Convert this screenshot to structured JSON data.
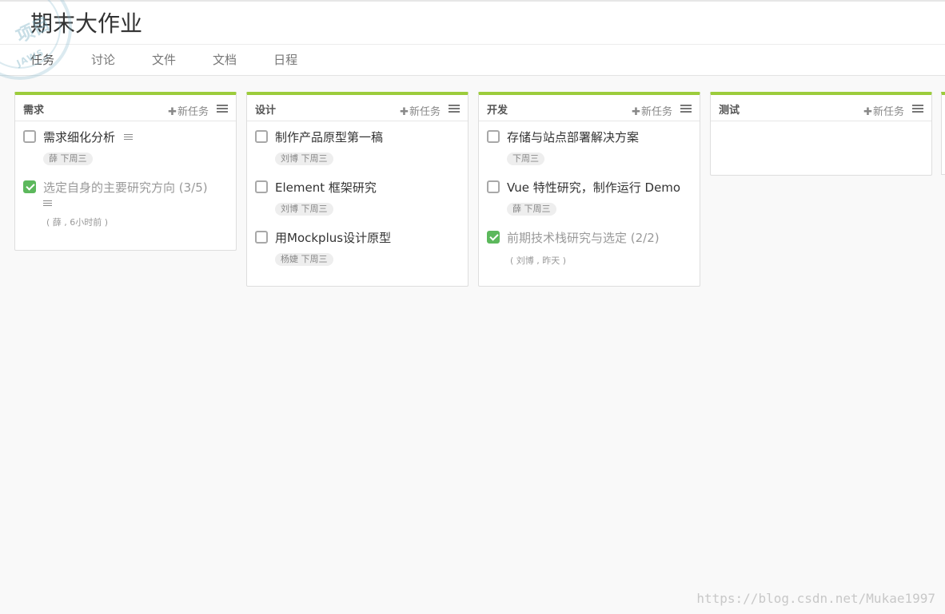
{
  "project": {
    "title": "期末大作业"
  },
  "stamp": {
    "text": "项目",
    "sub": "JAWS"
  },
  "tabs": [
    {
      "label": "任务",
      "active": true
    },
    {
      "label": "讨论"
    },
    {
      "label": "文件"
    },
    {
      "label": "文档"
    },
    {
      "label": "日程"
    }
  ],
  "add_task_label": "新任务",
  "columns": [
    {
      "name": "需求",
      "tasks": [
        {
          "title": "需求细化分析",
          "done": false,
          "has_note": true,
          "tag": "薛 下周三"
        },
        {
          "title": "选定自身的主要研究方向 (3/5)",
          "done": true,
          "has_note": true,
          "meta": "( 薛 , 6小时前 )"
        }
      ]
    },
    {
      "name": "设计",
      "tasks": [
        {
          "title": "制作产品原型第一稿",
          "done": false,
          "tag": "刘博 下周三"
        },
        {
          "title": "Element 框架研究",
          "done": false,
          "tag": "刘博 下周三"
        },
        {
          "title": "用Mockplus设计原型",
          "done": false,
          "tag": "杨婕 下周三"
        }
      ]
    },
    {
      "name": "开发",
      "tasks": [
        {
          "title": "存储与站点部署解决方案",
          "done": false,
          "tag": "下周三"
        },
        {
          "title": "Vue 特性研究，制作运行 Demo",
          "done": false,
          "tag": "薛 下周三"
        },
        {
          "title": "前期技术栈研究与选定 (2/2)",
          "done": true,
          "meta": "( 刘博 , 昨天 )"
        }
      ]
    },
    {
      "name": "测试",
      "tasks": []
    }
  ],
  "watermark": "https://blog.csdn.net/Mukae1997",
  "colors": {
    "accent": "#9ccc3c",
    "check": "#5cb85c"
  }
}
